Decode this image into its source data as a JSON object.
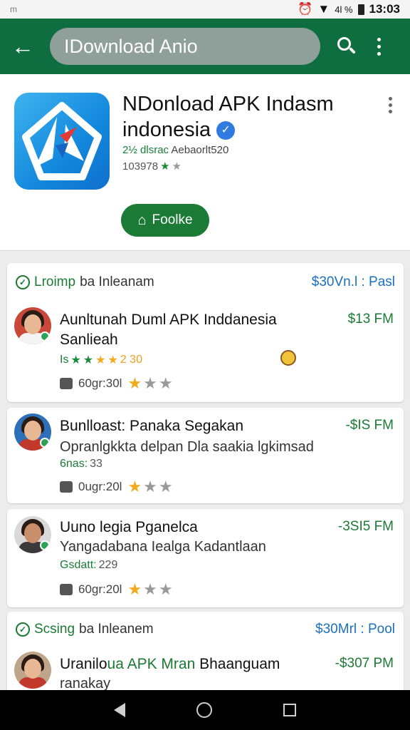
{
  "status": {
    "left": "m",
    "signal_text": "4l %",
    "time": "13:03"
  },
  "appbar": {
    "search_text": "IDownload Anio"
  },
  "app": {
    "title": "NDonload APK Indasm indonesia",
    "developer_prefix": "2½ dlsrac",
    "developer_name": "Aebaorlt520",
    "rating_count": "103978",
    "follow_label": "Foolke"
  },
  "section1": {
    "icon_text": "Lroimp",
    "label": "ba Inleanam",
    "link": "$30Vn.l : Pasl"
  },
  "section2": {
    "icon_text": "Scsing",
    "label": "ba Inleanem",
    "link": "$30Mrl : Pool"
  },
  "items": [
    {
      "title": "Aunltunah Duml APK Inddanesia Sanlieah",
      "subtitle": "",
      "price": "$13 FM",
      "stat_label": "Is",
      "stat_value": "2 30",
      "meta": "60gr:30l"
    },
    {
      "title": "Bunlloast: Panaka Segakan",
      "subtitle": "Opranlgkkta delpan Dla saakia lgkimsad",
      "price": "-$IS FM",
      "stat_label": "6nas:",
      "stat_value": "33",
      "meta": "0ugr:20l"
    },
    {
      "title": "Uuno legia Pganelca",
      "subtitle": "Yangadabana Iealga Kadantlaan",
      "price": "-3SI5 FM",
      "stat_label": "Gsdatt:",
      "stat_value": "229",
      "meta": "60gr:20l"
    },
    {
      "title_a": "Uranilo",
      "title_b": "ua APK Mran",
      "title_c": "Bhaanguam",
      "subtitle": "ranakay",
      "price": "-$307 PM"
    }
  ]
}
